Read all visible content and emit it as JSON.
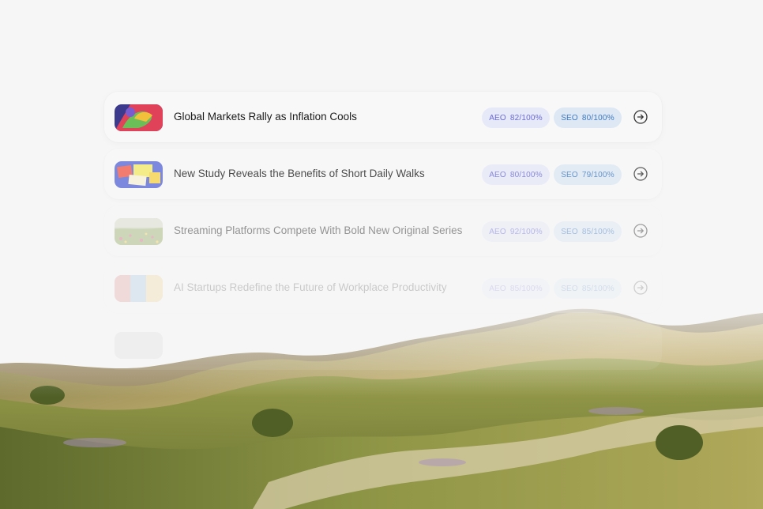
{
  "articles": [
    {
      "title": "Global Markets Rally as Inflation Cools",
      "aeo_label": "AEO",
      "aeo_score": "82/100%",
      "seo_label": "SEO",
      "seo_score": "80/100%",
      "thumbnail": "abstract-colorful-art-image"
    },
    {
      "title": "New Study Reveals the Benefits of Short Daily Walks",
      "aeo_label": "AEO",
      "aeo_score": "80/100%",
      "seo_label": "SEO",
      "seo_score": "79/100%",
      "thumbnail": "sticky-notes-image"
    },
    {
      "title": "Streaming Platforms Compete With Bold New Original Series",
      "aeo_label": "AEO",
      "aeo_score": "92/100%",
      "seo_label": "SEO",
      "seo_score": "85/100%",
      "thumbnail": "flower-field-image"
    },
    {
      "title": "AI Startups Redefine the Future of Workplace Productivity",
      "aeo_label": "AEO",
      "aeo_score": "85/100%",
      "seo_label": "SEO",
      "seo_score": "85/100%",
      "thumbnail": "abstract-pattern-image"
    },
    {
      "title": "",
      "aeo_label": "",
      "aeo_score": "",
      "seo_label": "",
      "seo_score": "",
      "thumbnail": "faded-image"
    }
  ],
  "icons": {
    "open": "arrow-right-circle-icon"
  },
  "colors": {
    "background": "#f6f6f6",
    "aeo_pill_bg": "#e6e9f8",
    "aeo_pill_text": "#6b6ad8",
    "seo_pill_bg": "#dde8f4",
    "seo_pill_text": "#3d78c2"
  }
}
